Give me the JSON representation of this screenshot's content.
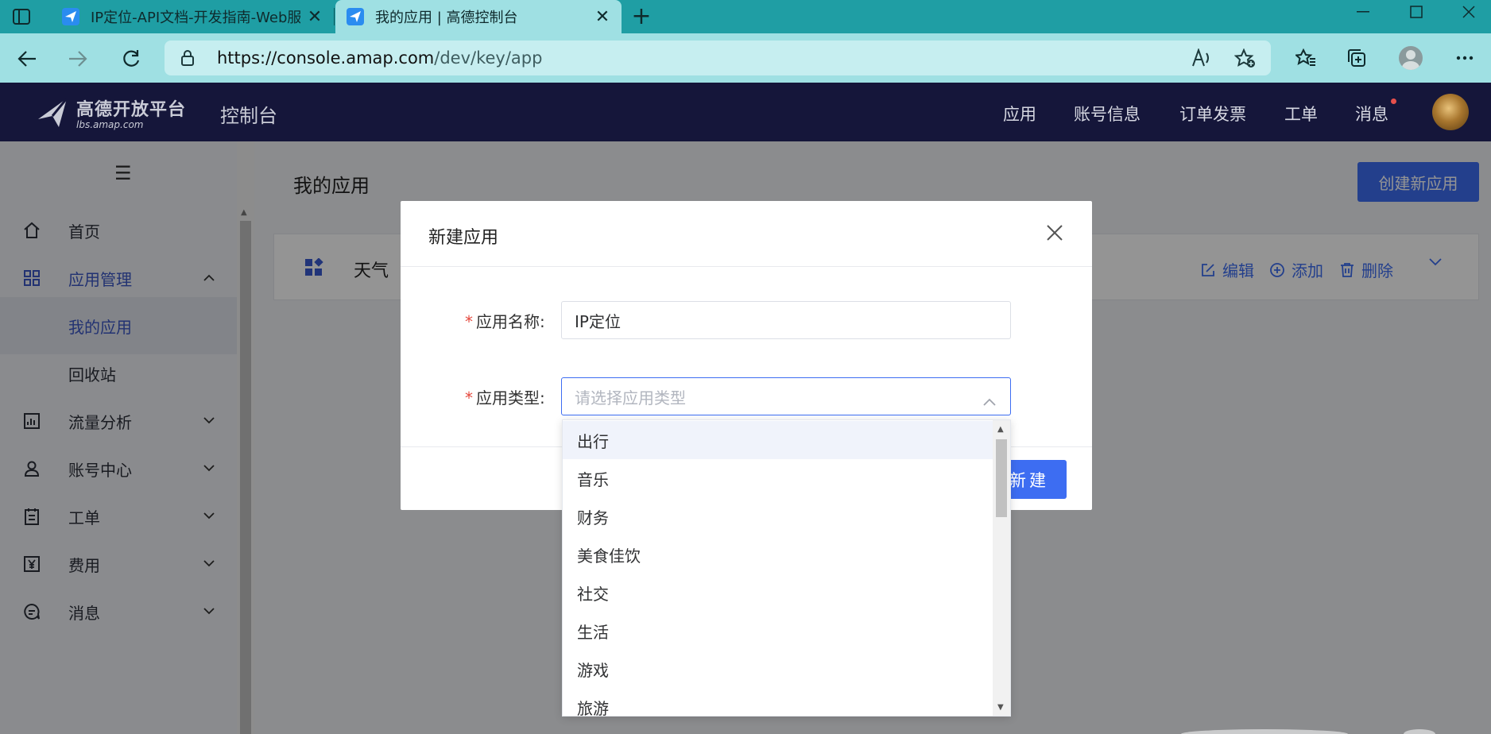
{
  "browser": {
    "tabs": [
      {
        "title": "IP定位-API文档-开发指南-Web服务",
        "favicon": "amap-plane-icon",
        "active": false
      },
      {
        "title": "我的应用 | 高德控制台",
        "favicon": "amap-plane-icon",
        "active": true
      }
    ],
    "url_host": "https://console.amap.com",
    "url_path": "/dev/key/app",
    "new_tab_label": "+",
    "close_glyph": "✕"
  },
  "header": {
    "logo_line1": "高德开放平台",
    "logo_line2": "lbs.amap.com",
    "console_title": "控制台",
    "nav": [
      "应用",
      "账号信息",
      "订单发票",
      "工单",
      "消息"
    ]
  },
  "sidebar": {
    "toggle_glyph": "☰",
    "items": [
      {
        "label": "首页",
        "icon": "home-icon"
      },
      {
        "label": "应用管理",
        "icon": "grid-icon"
      },
      {
        "label": "我的应用"
      },
      {
        "label": "回收站"
      },
      {
        "label": "流量分析",
        "icon": "chart-icon"
      },
      {
        "label": "账号中心",
        "icon": "user-icon"
      },
      {
        "label": "工单",
        "icon": "clipboard-icon"
      },
      {
        "label": "费用",
        "icon": "yen-icon"
      },
      {
        "label": "消息",
        "icon": "message-icon"
      }
    ]
  },
  "main": {
    "page_title": "我的应用",
    "create_button": "创建新应用",
    "app_card": {
      "name": "天气",
      "actions": {
        "edit": "编辑",
        "add": "添加",
        "delete": "删除"
      }
    }
  },
  "modal": {
    "title": "新建应用",
    "name_label": "应用名称:",
    "name_value": "IP定位",
    "type_label": "应用类型:",
    "type_placeholder": "请选择应用类型",
    "submit_label": "新建"
  },
  "dropdown": {
    "options": [
      "出行",
      "音乐",
      "财务",
      "美食佳饮",
      "社交",
      "生活",
      "游戏",
      "旅游"
    ],
    "hovered_index": 0
  },
  "colors": {
    "accent": "#3d6df2",
    "header_bg": "#15163a",
    "browser_tab_bg": "#1f9ea4",
    "required_star": "#e5483d"
  }
}
